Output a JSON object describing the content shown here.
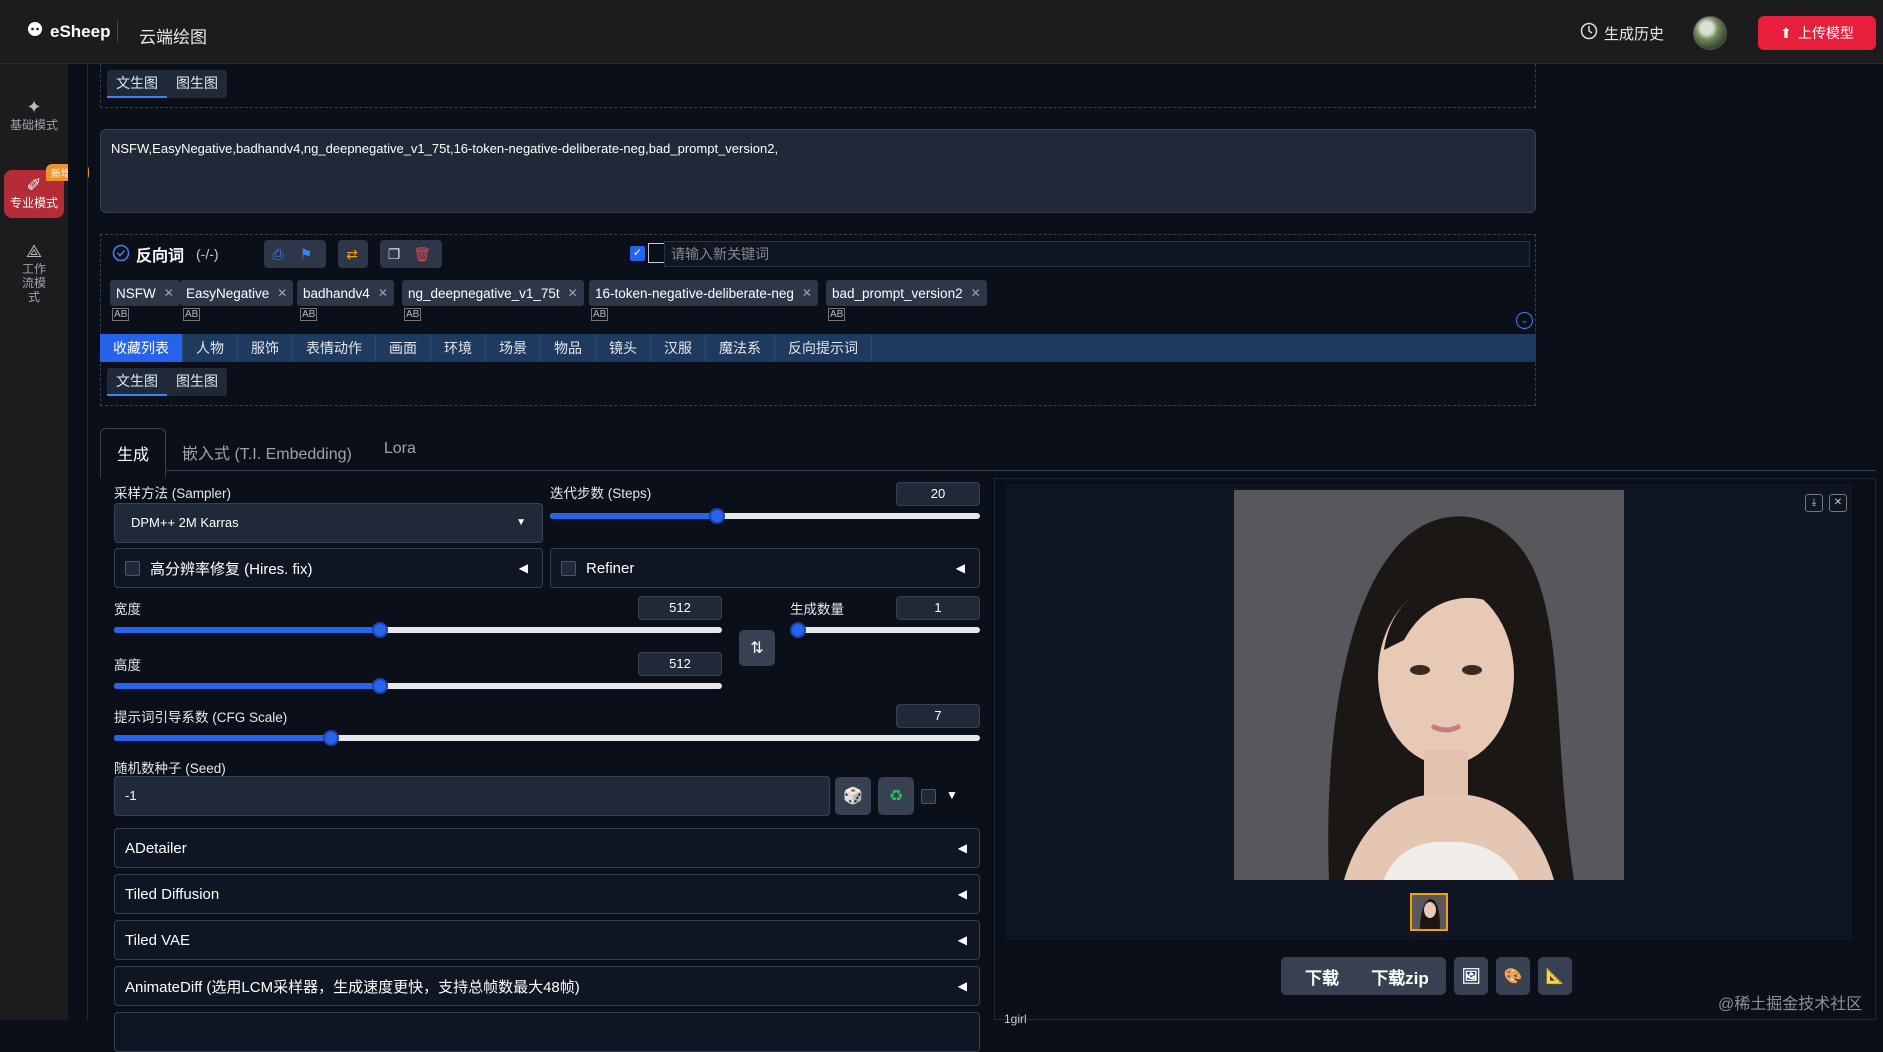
{
  "app": {
    "logo_text": "eSheep",
    "title": "云端绘图"
  },
  "header": {
    "history_label": "生成历史",
    "upload_label": "上传模型"
  },
  "colors": {
    "accent": "#2563eb",
    "brand_red": "#e81f3c",
    "badge_orange": "#f0932b"
  },
  "nav": {
    "items": [
      {
        "label": "基础模式",
        "icon": "sparkle-icon"
      },
      {
        "label": "专业模式",
        "icon": "brush-icon",
        "badge": "新增MJ",
        "active": true
      },
      {
        "label": "工作流模式",
        "icon": "workflow-icon"
      }
    ]
  },
  "subtabs": [
    "文生图",
    "图生图"
  ],
  "prompt": {
    "value": "NSFW,EasyNegative,badhandv4,ng_deepnegative_v1_75t,16-token-negative-deliberate-neg,bad_prompt_version2,"
  },
  "negative": {
    "title": "反向词",
    "count": "(-/-)",
    "keyword_placeholder": "请输入新关键词",
    "tags": [
      "NSFW",
      "EasyNegative",
      "badhandv4",
      "ng_deepnegative_v1_75t",
      "16-token-negative-deliberate-neg",
      "bad_prompt_version2"
    ]
  },
  "categories": [
    "收藏列表",
    "人物",
    "服饰",
    "表情动作",
    "画面",
    "环境",
    "场景",
    "物品",
    "镜头",
    "汉服",
    "魔法系",
    "反向提示词"
  ],
  "main_tabs": [
    "生成",
    "嵌入式 (T.I. Embedding)",
    "Lora"
  ],
  "params": {
    "sampler_label": "采样方法 (Sampler)",
    "sampler_value": "DPM++ 2M Karras",
    "steps_label": "迭代步数 (Steps)",
    "steps": 20,
    "steps_max": 50,
    "hires_label": "高分辨率修复 (Hires. fix)",
    "refiner_label": "Refiner",
    "width_label": "宽度",
    "width": 512,
    "height_label": "高度",
    "height": 512,
    "size_max": 1088,
    "batch_label": "生成数量",
    "batch": 1,
    "cfg_label": "提示词引导系数 (CFG Scale)",
    "cfg": 7,
    "cfg_max": 25,
    "seed_label": "随机数种子 (Seed)",
    "seed": "-1"
  },
  "accordions": [
    "ADetailer",
    "Tiled Diffusion",
    "Tiled VAE",
    "AnimateDiff (选用LCM采样器，生成速度更快，支持总帧数最大48帧)"
  ],
  "output": {
    "download": "下载",
    "download_zip": "下载zip",
    "grid_label": "1girl"
  },
  "watermark": "@稀土掘金技术社区"
}
